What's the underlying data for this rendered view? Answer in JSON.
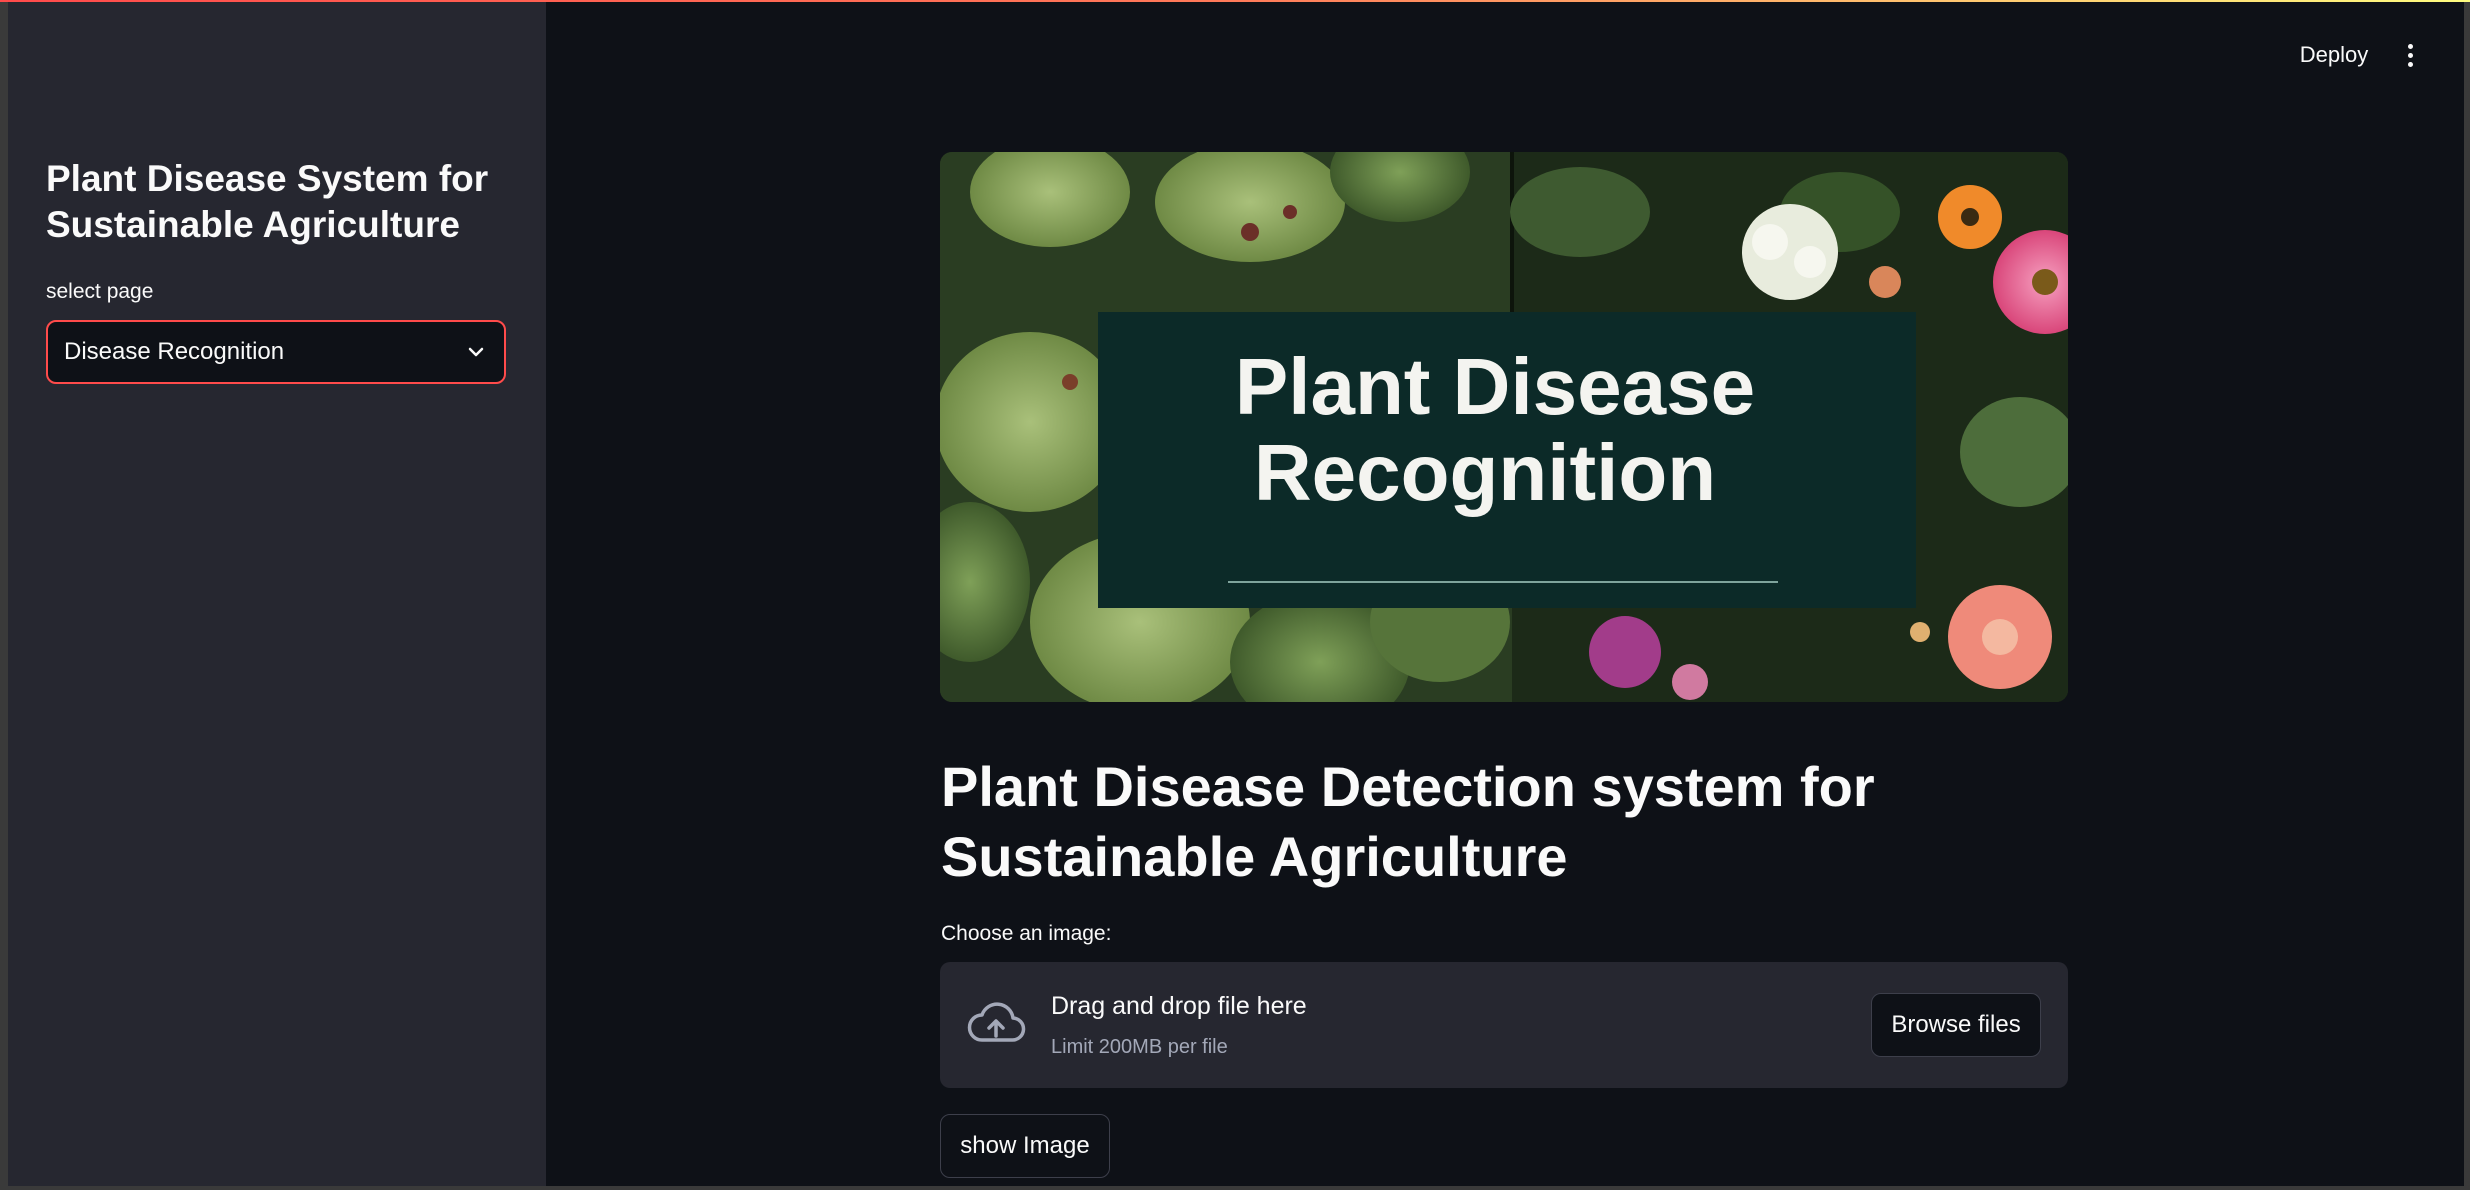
{
  "header": {
    "deploy_label": "Deploy",
    "menu_icon": "vertical-dots-icon"
  },
  "sidebar": {
    "title": "Plant Disease System for Sustainable Agriculture",
    "select_label": "select page",
    "select_value": "Disease Recognition",
    "select_icon": "chevron-down-icon"
  },
  "banner": {
    "line1": "Plant Disease",
    "line2": "Recognition"
  },
  "main": {
    "title": "Plant Disease Detection system for Sustainable Agriculture",
    "uploader": {
      "label": "Choose an image:",
      "drop_text": "Drag and drop file here",
      "limit_text": "Limit 200MB per file",
      "browse_label": "Browse files",
      "icon": "cloud-upload-icon"
    },
    "show_button_label": "show Image"
  },
  "colors": {
    "background": "#0e1117",
    "sidebar": "#262730",
    "accent": "#ff4b4b",
    "text": "#fafafa",
    "muted": "#a3a8b8"
  }
}
